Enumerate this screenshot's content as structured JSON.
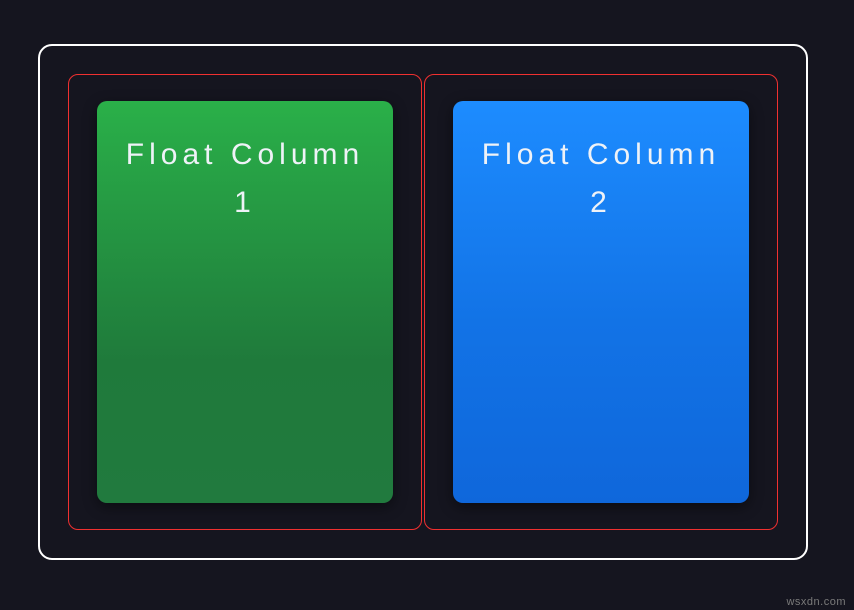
{
  "columns": [
    {
      "title": "Float Column 1"
    },
    {
      "title": "Float Column 2"
    }
  ],
  "watermark": "wsxdn.com"
}
